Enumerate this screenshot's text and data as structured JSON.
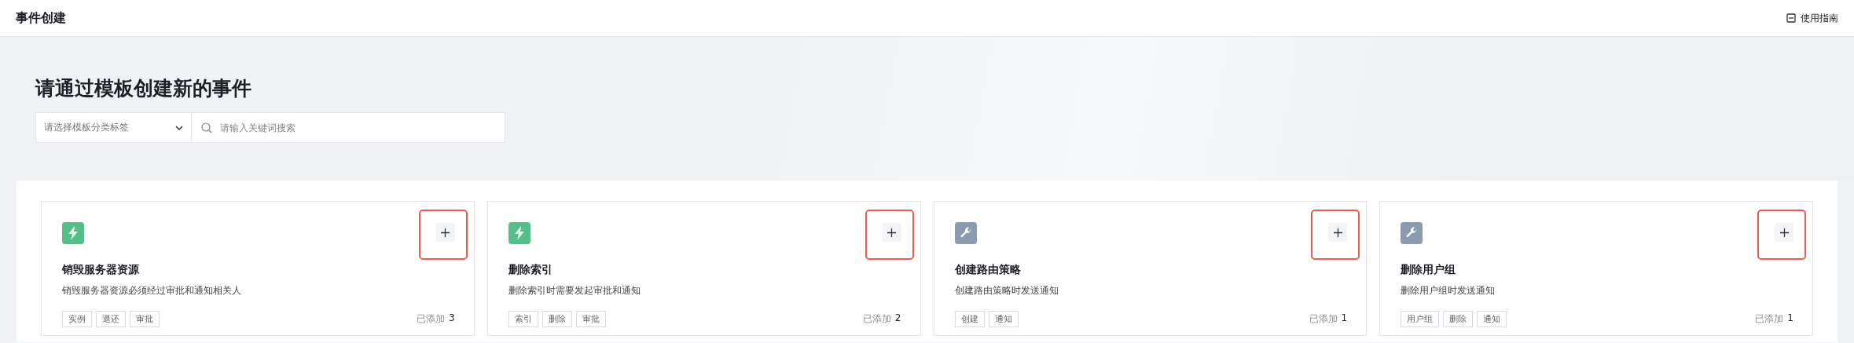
{
  "header": {
    "title": "事件创建",
    "guide_link": "使用指南"
  },
  "hero": {
    "title": "请通过模板创建新的事件",
    "category_select": {
      "placeholder": "请选择模板分类标签"
    },
    "search": {
      "placeholder": "请输入关键词搜索"
    }
  },
  "cards": [
    {
      "kind": "bolt",
      "title": "销毁服务器资源",
      "description": "销毁服务器资源必须经过审批和通知相关人",
      "tags": [
        "实例",
        "退还",
        "审批"
      ],
      "count_label": "已添加",
      "count": "3",
      "highlighted": true
    },
    {
      "kind": "bolt",
      "title": "删除索引",
      "description": "删除索引时需要发起审批和通知",
      "tags": [
        "索引",
        "删除",
        "审批"
      ],
      "count_label": "已添加",
      "count": "2",
      "highlighted": true
    },
    {
      "kind": "wrench",
      "title": "创建路由策略",
      "description": "创建路由策略时发送通知",
      "tags": [
        "创建",
        "通知"
      ],
      "count_label": "已添加",
      "count": "1",
      "highlighted": true
    },
    {
      "kind": "wrench",
      "title": "删除用户组",
      "description": "删除用户组时发送通知",
      "tags": [
        "用户组",
        "删除",
        "通知"
      ],
      "count_label": "已添加",
      "count": "1",
      "highlighted": true
    }
  ]
}
